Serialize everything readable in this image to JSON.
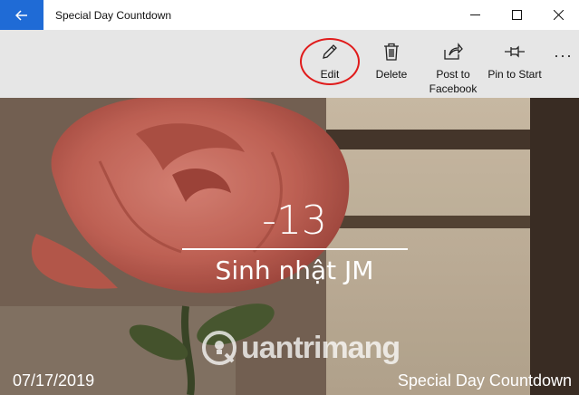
{
  "window": {
    "title": "Special Day Countdown",
    "accent": "#1f6bd6"
  },
  "commands": {
    "edit_label": "Edit",
    "delete_label": "Delete",
    "post_label": "Post to Facebook",
    "pin_label": "Pin to Start",
    "more_label": "···"
  },
  "event": {
    "count": "-13",
    "name": "Sinh nhật JM",
    "date": "07/17/2019",
    "app_label": "Special Day Countdown"
  },
  "watermark": {
    "text": "uantrimang"
  },
  "colors": {
    "highlight_ring": "#e01b1b",
    "command_bar": "#e6e6e6"
  }
}
